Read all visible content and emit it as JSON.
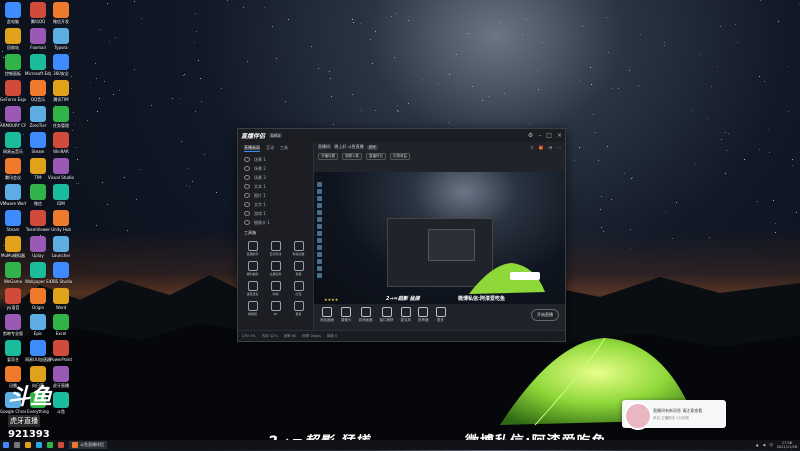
{
  "desktop": {
    "icons_col1": [
      "此电脑",
      "回收站",
      "控制面板",
      "GeForce Experience",
      "ARMOURY CRATE",
      "网易云音乐",
      "腾讯会议",
      "VMware Workstation",
      "Steam",
      "MuMu模拟器",
      "WeGame",
      "yy语音",
      "剪映专业版",
      "爱奇艺",
      "迅雷",
      "Google Chrome"
    ],
    "icons_col2": [
      "腾讯QQ",
      "Foxmail",
      "Microsoft Edge",
      "QQ音乐",
      "ZeroTier",
      "Steam",
      "TIM",
      "微信",
      "TeamViewer",
      "Uplay",
      "Wallpaper Engine",
      "Origin",
      "Epic",
      "网易UU加速器",
      "向日葵",
      "Everything"
    ],
    "icons_col3": [
      "微信开发",
      "Typora",
      "360安全",
      "腾讯TIM",
      "任务管理",
      "WinRAR",
      "Visual Studio Code",
      "IDM",
      "Unity Hub",
      "Launcher",
      "OBS Studio",
      "Word",
      "Excel",
      "PowerPoint",
      "虎牙直播",
      "斗鱼"
    ]
  },
  "badge": {
    "logo": "斗鱼",
    "sub": "虎牙直播",
    "number": "921393"
  },
  "obs": {
    "app_name": "直播伴侣",
    "version": "beta",
    "tabs": [
      "直播画面",
      "互动",
      "工具"
    ],
    "scenes": [
      "场景 1",
      "场景 2",
      "场景 3",
      "文本 1",
      "图片 1",
      "文字 1",
      "游戏 1",
      "摄像头 1"
    ],
    "toolbox_title": "工具箱",
    "tools": [
      "直播助手",
      "互动玩法",
      "粉丝勋章",
      "福利抽奖",
      "主播任务",
      "投票",
      "语音连麦",
      "商城",
      "红包",
      "弹幕姬",
      "PK",
      "更多"
    ],
    "header": {
      "label": "直播间:",
      "room": "晚上好 斗鱼直播",
      "tag": "游戏",
      "line2": [
        "开播设置",
        "观看人数",
        "直播时长",
        "礼物收益"
      ]
    },
    "preview": {
      "text1": "2→=超影 猛搓",
      "text2": "微博私信:阿漆爱吃鱼",
      "stars": "★★★★"
    },
    "controls": [
      "添加画面",
      "摄像头",
      "游戏画面",
      "窗口捕获",
      "麦克风",
      "扬声器",
      "更多"
    ],
    "golive": "开始直播",
    "status": [
      "CPU 3%",
      "内存 42%",
      "帧率 60",
      "码率 0kbps",
      "掉帧 0"
    ]
  },
  "notification": {
    "line1": "直播间有新消息 请注意查看",
    "line2": "来自 主播助手 2分钟前"
  },
  "captions": {
    "left": "2→=超影  猛搓",
    "right": "微博私信:阿漆爱吃鱼"
  },
  "taskbar": {
    "active_app": "斗鱼直播伴侣",
    "time": "17:58",
    "date": "2021/11/26",
    "lang": "中"
  }
}
